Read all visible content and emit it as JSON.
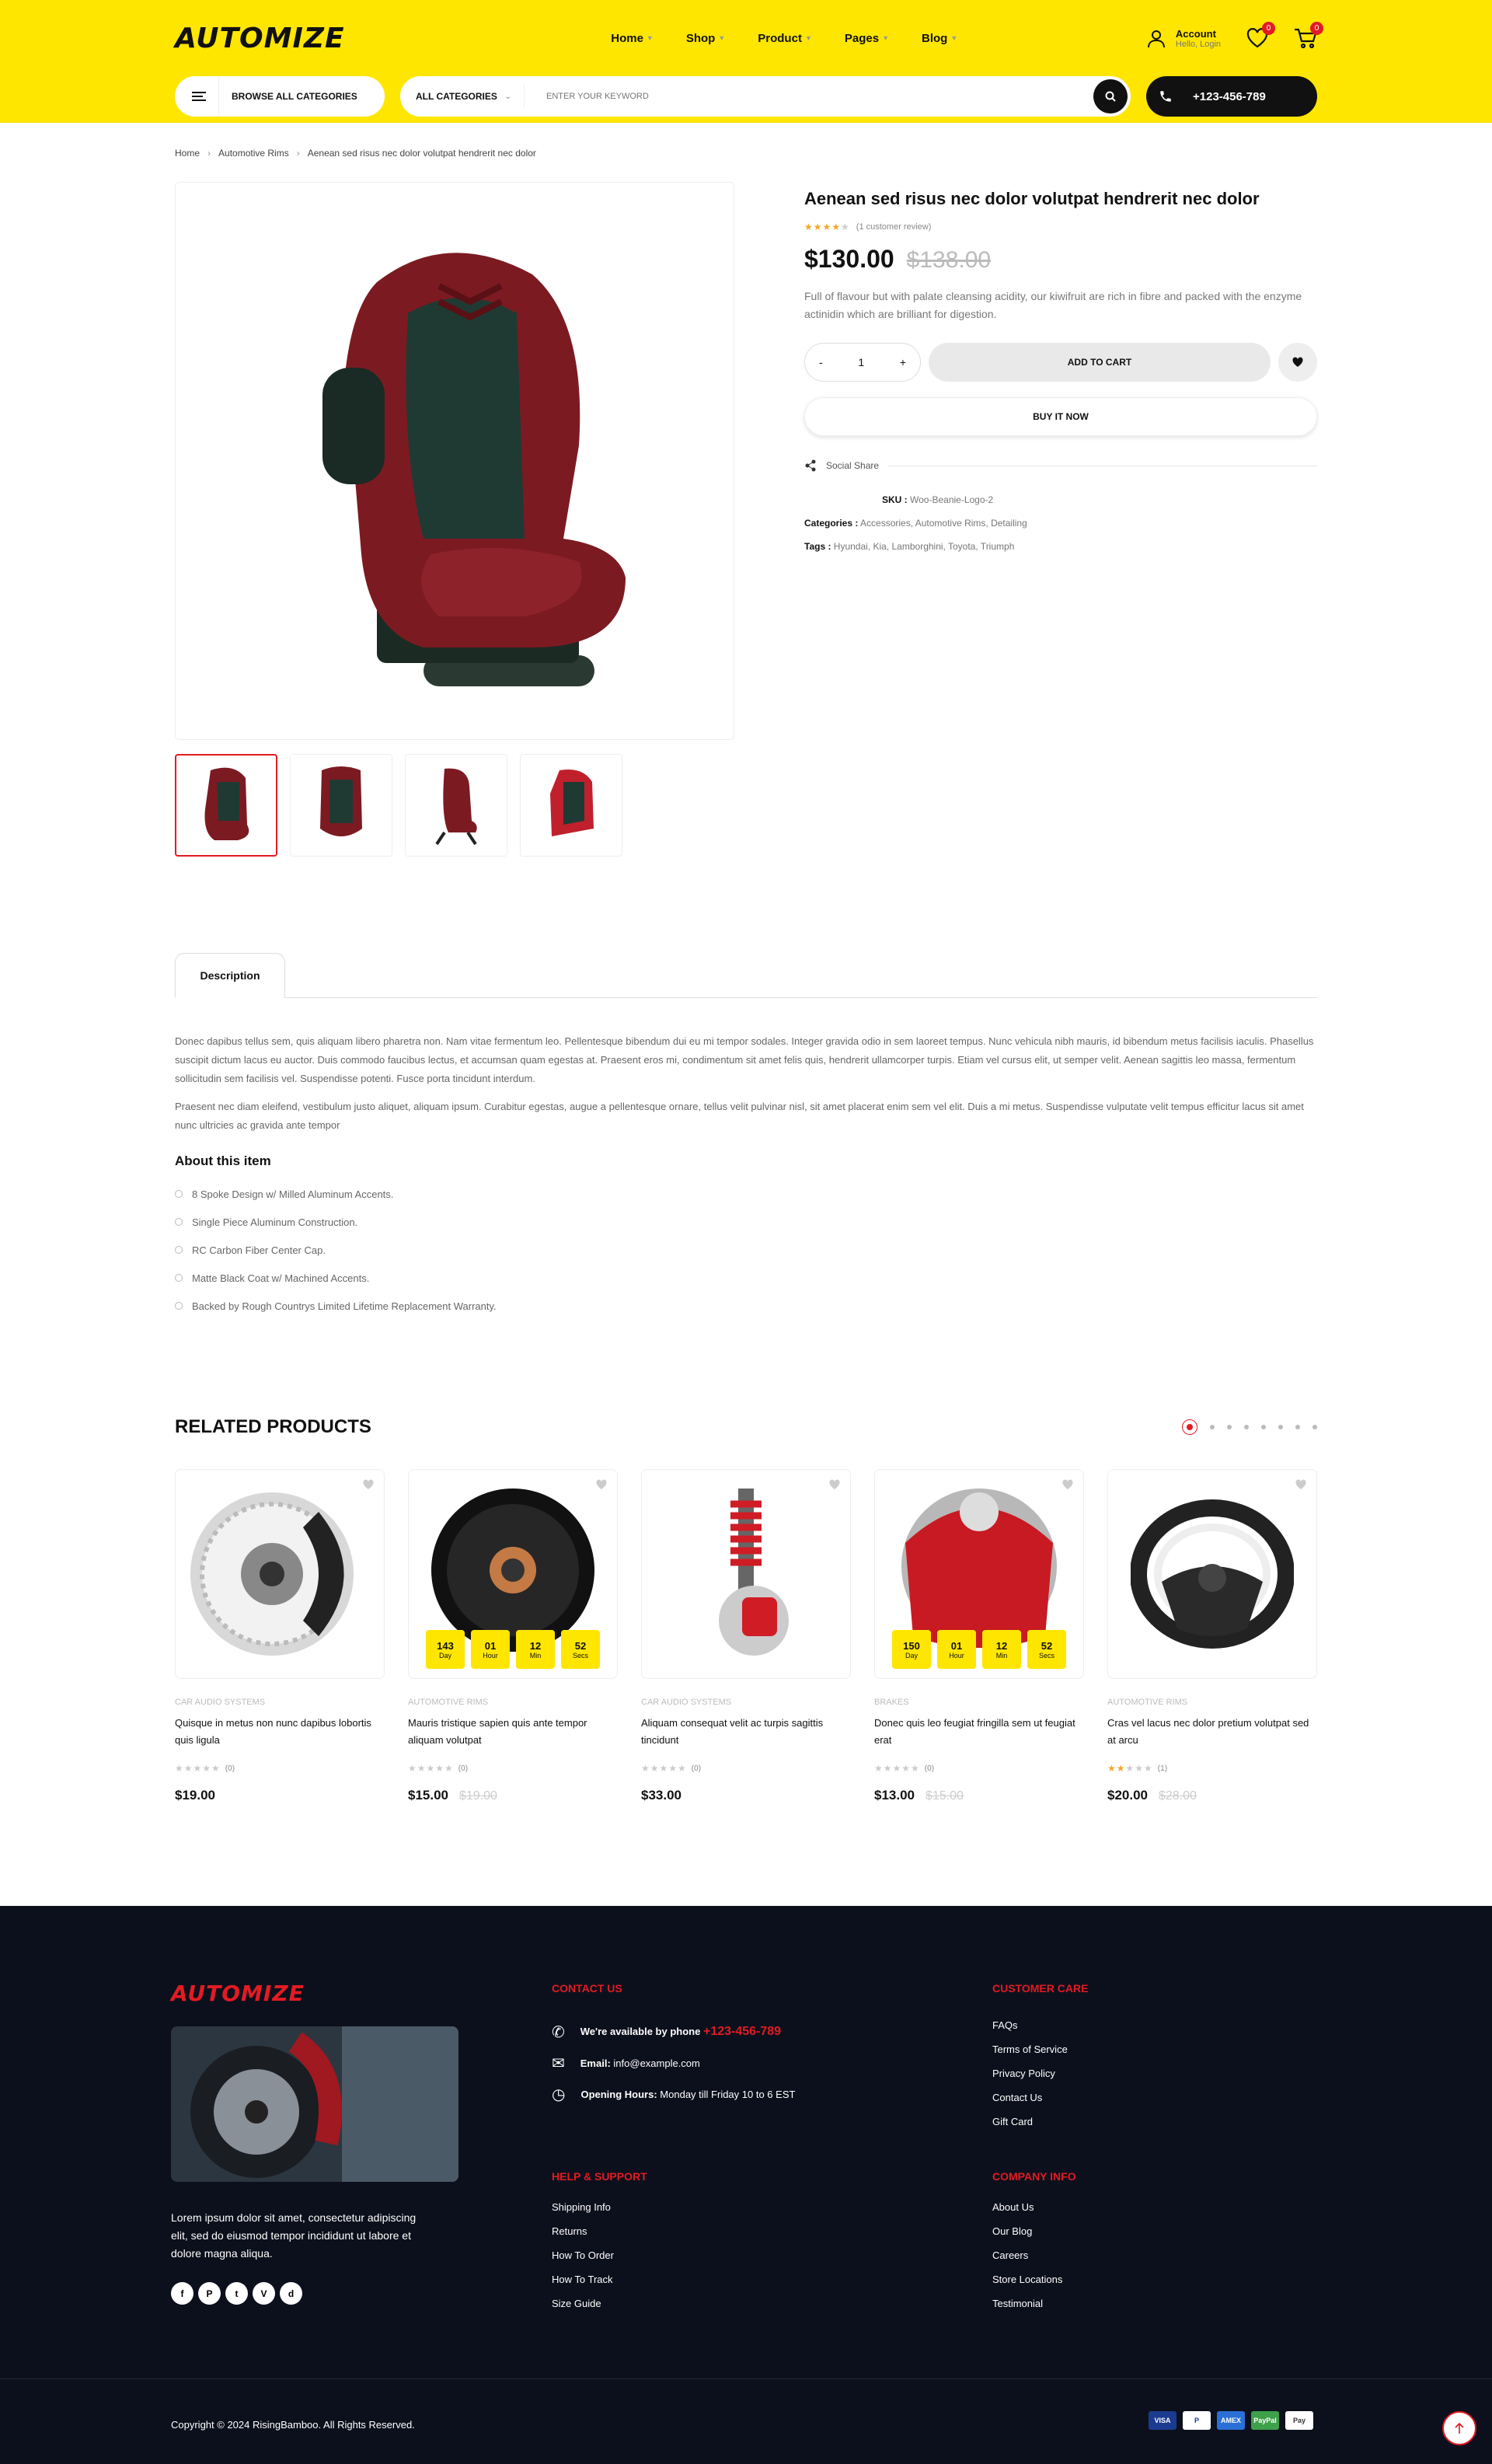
{
  "header": {
    "logo": "AUTOMIZE",
    "nav": [
      "Home",
      "Shop",
      "Product",
      "Pages",
      "Blog"
    ],
    "account_label": "Account",
    "account_sub": "Hello, Login",
    "wishlist_count": "0",
    "cart_count": "0",
    "browse_label": "BROWSE ALL CATEGORIES",
    "category_select": "ALL CATEGORIES",
    "search_placeholder": "ENTER YOUR KEYWORD",
    "phone": "+123-456-789",
    "accent": "#ffe600"
  },
  "breadcrumb": [
    "Home",
    "Automotive Rims",
    "Aenean sed risus nec dolor volutpat hendrerit nec dolor"
  ],
  "product": {
    "title": "Aenean sed risus nec dolor volutpat hendrerit nec dolor",
    "rating": 4,
    "review_text": "(1 customer review)",
    "price": "$130.00",
    "old_price": "$138.00",
    "description": "Full of flavour but with palate cleansing acidity, our kiwifruit are rich in fibre and packed with the enzyme actinidin which are brilliant for digestion.",
    "qty_minus": "-",
    "qty": "1",
    "qty_plus": "+",
    "add_to_cart": "ADD TO CART",
    "buy_now": "BUY IT NOW",
    "social_share": "Social Share",
    "sku_label": "SKU :",
    "sku": "Woo-Beanie-Logo-2",
    "categories_label": "Categories :",
    "categories": "Accessories, Automotive Rims, Detailing",
    "tags_label": "Tags :",
    "tags": "Hyundai, Kia, Lamborghini, Toyota, Triumph"
  },
  "description": {
    "tab": "Description",
    "p1": "Donec dapibus tellus sem, quis aliquam libero pharetra non. Nam vitae fermentum leo. Pellentesque bibendum dui eu mi tempor sodales. Integer gravida odio in sem laoreet tempus. Nunc vehicula nibh mauris, id bibendum metus facilisis iaculis. Phasellus suscipit dictum lacus eu auctor. Duis commodo faucibus lectus, et accumsan quam egestas at. Praesent eros mi, condimentum sit amet felis quis, hendrerit ullamcorper turpis. Etiam vel cursus elit, ut semper velit. Aenean sagittis leo massa, fermentum sollicitudin sem facilisis vel. Suspendisse potenti. Fusce porta tincidunt interdum.",
    "p2": "Praesent nec diam eleifend, vestibulum justo aliquet, aliquam ipsum. Curabitur egestas, augue a pellentesque ornare, tellus velit pulvinar nisl, sit amet placerat enim sem vel elit. Duis a mi metus. Suspendisse vulputate velit tempus efficitur lacus sit amet nunc ultricies ac gravida ante tempor",
    "about_title": "About this item",
    "bullets": [
      "8 Spoke Design w/ Milled Aluminum Accents.",
      "Single Piece Aluminum Construction.",
      "RC Carbon Fiber Center Cap.",
      "Matte Black Coat w/ Machined Accents.",
      "Backed by Rough Countrys Limited Lifetime Replacement Warranty."
    ]
  },
  "related": {
    "title": "RELATED PRODUCTS",
    "items": [
      {
        "category": "CAR AUDIO SYSTEMS",
        "name": "Quisque in metus non nunc dapibus lobortis quis ligula",
        "rating": 0,
        "reviews": "(0)",
        "price": "$19.00",
        "old_price": "",
        "timer": null
      },
      {
        "category": "AUTOMOTIVE RIMS",
        "name": "Mauris tristique sapien quis ante tempor aliquam volutpat",
        "rating": 0,
        "reviews": "(0)",
        "price": "$15.00",
        "old_price": "$19.00",
        "timer": {
          "d": "143",
          "h": "01",
          "m": "12",
          "s": "52"
        }
      },
      {
        "category": "CAR AUDIO SYSTEMS",
        "name": "Aliquam consequat velit ac turpis sagittis tincidunt",
        "rating": 0,
        "reviews": "(0)",
        "price": "$33.00",
        "old_price": "",
        "timer": null
      },
      {
        "category": "BRAKES",
        "name": "Donec quis leo feugiat fringilla sem ut feugiat erat",
        "rating": 0,
        "reviews": "(0)",
        "price": "$13.00",
        "old_price": "$15.00",
        "timer": {
          "d": "150",
          "h": "01",
          "m": "12",
          "s": "52"
        }
      },
      {
        "category": "AUTOMOTIVE RIMS",
        "name": "Cras vel lacus nec dolor pretium volutpat sed at arcu",
        "rating": 2,
        "reviews": "(1)",
        "price": "$20.00",
        "old_price": "$28.00",
        "timer": null
      }
    ],
    "timer_labels": {
      "d": "Day",
      "h": "Hour",
      "m": "Min",
      "s": "Secs"
    }
  },
  "footer": {
    "logo": "AUTOMIZE",
    "about": "Lorem ipsum dolor sit amet, consectetur adipiscing elit, sed do eiusmod tempor incididunt ut labore et dolore magna aliqua.",
    "social": [
      "f",
      "P",
      "t",
      "V",
      "d"
    ],
    "contact_title": "CONTACT US",
    "phone_label": "We're available by phone",
    "phone": "+123-456-789",
    "email_label": "Email:",
    "email": "info@example.com",
    "hours_label": "Opening Hours:",
    "hours": "Monday till Friday 10 to 6 EST",
    "help_title": "HELP & SUPPORT",
    "help_links": [
      "Shipping Info",
      "Returns",
      "How To Order",
      "How To Track",
      "Size Guide"
    ],
    "care_title": "CUSTOMER CARE",
    "care_links": [
      "FAQs",
      "Terms of Service",
      "Privacy Policy",
      "Contact Us",
      "Gift Card"
    ],
    "company_title": "COMPANY INFO",
    "company_links": [
      "About Us",
      "Our Blog",
      "Careers",
      "Store Locations",
      "Testimonial"
    ],
    "copyright": "Copyright © 2024 RisingBamboo. All Rights Reserved.",
    "payments": [
      "VISA",
      "P",
      "AMEX",
      "PayPal",
      "Pay"
    ]
  }
}
